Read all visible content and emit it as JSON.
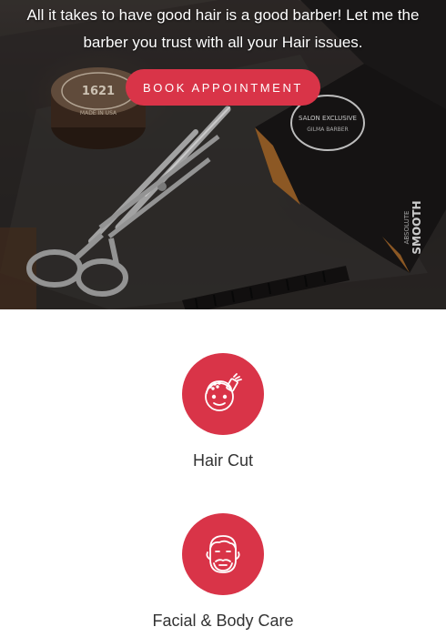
{
  "hero": {
    "line1": "All it takes to have good hair is a good barber! Let me the",
    "line2": "barber you trust with all your Hair issues.",
    "button_label": "BOOK APPOINTMENT",
    "tin_text": "1621",
    "tin_ring_text": "MADE IN USA",
    "clipper_brand": "SMOOTH",
    "clipper_tag": "ABSOLUTE",
    "clipper_badge": "SALON EXCLUSIVE",
    "clipper_badge_sub": "GILMA BARBER"
  },
  "services": [
    {
      "label": "Hair Cut",
      "icon": "haircut-icon"
    },
    {
      "label": "Facial & Body Care",
      "icon": "bearded-face-icon"
    }
  ],
  "colors": {
    "accent": "#d93448",
    "text": "#333333",
    "hero_bg": "#2a2624"
  }
}
